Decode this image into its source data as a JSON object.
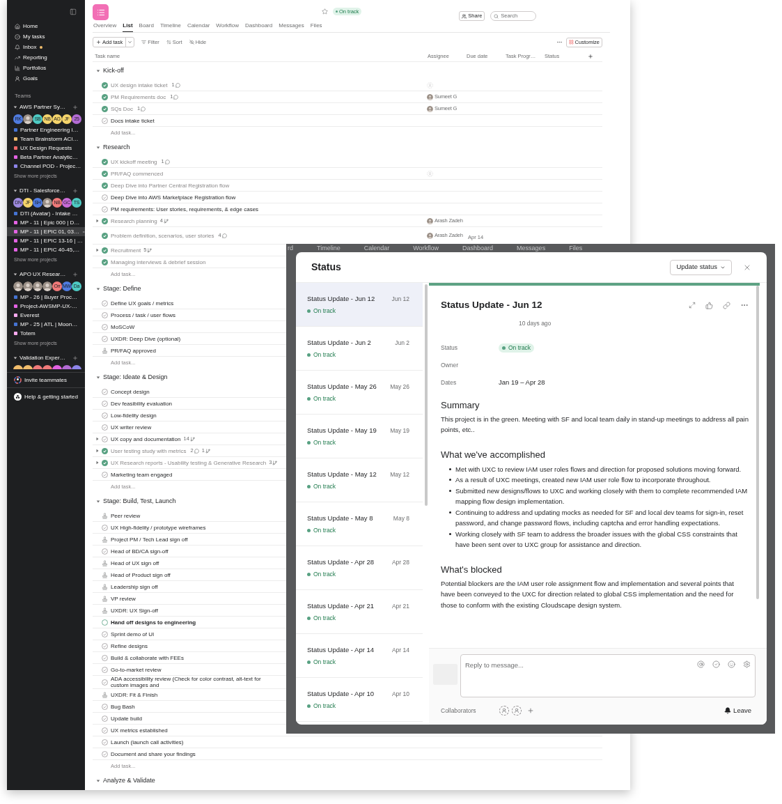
{
  "sidebar": {
    "nav": [
      {
        "label": "Home",
        "kind": "home"
      },
      {
        "label": "My tasks",
        "kind": "tasks"
      },
      {
        "label": "Inbox",
        "kind": "inbox",
        "unread": true
      },
      {
        "label": "Reporting",
        "kind": "reporting"
      },
      {
        "label": "Portfolios",
        "kind": "portfolios"
      },
      {
        "label": "Goals",
        "kind": "goals"
      }
    ],
    "teams_label": "Teams",
    "teams": [
      {
        "name": "AWS Partner Sy…",
        "expanded": true,
        "avatars": [
          {
            "kind": "initials",
            "initials": "RK",
            "color": "#4f7be0"
          },
          {
            "kind": "photo"
          },
          {
            "kind": "initials",
            "initials": "SB",
            "color": "#4ecbc4"
          },
          {
            "kind": "initials",
            "initials": "NB",
            "color": "#f5d46b"
          },
          {
            "kind": "initials",
            "initials": "AG",
            "color": "#f5d46b"
          },
          {
            "kind": "initials",
            "initials": "JF",
            "color": "#f5d46b"
          },
          {
            "kind": "initials",
            "initials": "25",
            "color": "#b36bd4"
          }
        ],
        "projects": [
          {
            "name": "Partner Engineering I…",
            "color": "#4573d2",
            "selected": false
          },
          {
            "name": "Team Brainstorm ACI…",
            "color": "#f1bd6c",
            "selected": false
          },
          {
            "name": "UX Design Requests",
            "color": "#f06a6a",
            "selected": false
          },
          {
            "name": "Beta Partner Analytic…",
            "color": "#e362e3",
            "selected": false
          },
          {
            "name": "Channel POD - Projec…",
            "color": "#8d84e8",
            "selected": false
          }
        ],
        "more": "Show more projects"
      },
      {
        "name": "DTI - Salesforce…",
        "expanded": true,
        "avatars": [
          {
            "kind": "initials",
            "initials": "DN",
            "color": "#9e8ae0"
          },
          {
            "kind": "initials",
            "initials": "JF",
            "color": "#f5d46b"
          },
          {
            "kind": "initials",
            "initials": "SH",
            "color": "#4f7be0"
          },
          {
            "kind": "photo"
          },
          {
            "kind": "initials",
            "initials": "NB",
            "color": "#f07a7a"
          },
          {
            "kind": "initials",
            "initials": "GC",
            "color": "#c86bd8"
          },
          {
            "kind": "initials",
            "initials": "TS",
            "color": "#4ecbc4"
          }
        ],
        "projects": [
          {
            "name": "DTI (Avatar) - Intake …",
            "color": "#4573d2",
            "selected": false
          },
          {
            "name": "MP - 11 | Epic 000 | D…",
            "color": "#e362e3",
            "selected": false
          },
          {
            "name": "MP - 11 | EPIC 01, 03…",
            "color": "#e362e3",
            "selected": true
          },
          {
            "name": "MP - 11 | EPIC 13-16 | …",
            "color": "#e362e3",
            "selected": false
          },
          {
            "name": "MP - 11 | EPIC 40-45,…",
            "color": "#e362e3",
            "selected": false
          }
        ],
        "more": "Show more projects"
      },
      {
        "name": "APO UX Resear…",
        "expanded": true,
        "avatars": [
          {
            "kind": "photo"
          },
          {
            "kind": "photo"
          },
          {
            "kind": "photo"
          },
          {
            "kind": "photo"
          },
          {
            "kind": "initials",
            "initials": "Orr",
            "color": "#f07a7a"
          },
          {
            "kind": "initials",
            "initials": "MW",
            "color": "#4f7be0"
          },
          {
            "kind": "initials",
            "initials": "Da",
            "color": "#4ecbc4"
          }
        ],
        "projects": [
          {
            "name": "MP - 26 | Buyer Proc…",
            "color": "#4573d2",
            "selected": false
          },
          {
            "name": "Project-AWSMP-UX-…",
            "color": "#e362e3",
            "selected": false
          },
          {
            "name": "Everest",
            "color": "#f9aaef",
            "selected": false
          },
          {
            "name": "MP - 25 | ATL | Moon…",
            "color": "#4573d2",
            "selected": false
          },
          {
            "name": "Totem",
            "color": "#f9aaef",
            "selected": false
          }
        ],
        "more": "Show more projects"
      },
      {
        "name": "Validation Exper…",
        "expanded": true,
        "avatars": [
          {
            "kind": "clipped",
            "color": "#f1bd6c"
          },
          {
            "kind": "clipped",
            "color": "#f1bd6c"
          },
          {
            "kind": "clipped",
            "color": "#f07a7a"
          },
          {
            "kind": "clipped",
            "color": "#f07a7a"
          },
          {
            "kind": "clipped",
            "color": "#e362e3"
          },
          {
            "kind": "clipped",
            "color": "#b36bd4"
          },
          {
            "kind": "clipped",
            "color": "#8d84e8"
          }
        ]
      }
    ],
    "invite": "Invite teammates",
    "help": "Help & getting started"
  },
  "header": {
    "starred": false,
    "status": "On track",
    "share": "Share",
    "search": {
      "placeholder": "Search"
    }
  },
  "tabs": [
    {
      "label": "Overview",
      "selected": false
    },
    {
      "label": "List",
      "selected": true
    },
    {
      "label": "Board",
      "selected": false
    },
    {
      "label": "Timeline",
      "selected": false
    },
    {
      "label": "Calendar",
      "selected": false
    },
    {
      "label": "Workflow",
      "selected": false
    },
    {
      "label": "Dashboard",
      "selected": false
    },
    {
      "label": "Messages",
      "selected": false
    },
    {
      "label": "Files",
      "selected": false
    }
  ],
  "toolbar": {
    "add": "Add task",
    "filter": "Filter",
    "sort": "Sort",
    "hide": "Hide",
    "customize": "Customize"
  },
  "columns": [
    "Task name",
    "Assignee",
    "Due date",
    "Task Progr…",
    "Status"
  ],
  "sections": [
    {
      "name": "Kick-off",
      "expanded": true,
      "add_label": "Add task...",
      "tasks": [
        {
          "name": "UX design intake ticket",
          "kind": "done",
          "comments": "1",
          "assignee": {
            "kind": "empty"
          }
        },
        {
          "name": "PM Requirements doc",
          "kind": "done",
          "comments": "1",
          "assignee": {
            "kind": "person",
            "name": "Sumeet G"
          }
        },
        {
          "name": "SQs Doc",
          "kind": "done",
          "comments": "1",
          "assignee": {
            "kind": "person",
            "name": "Sumeet G"
          }
        },
        {
          "name": "Docs intake ticket",
          "kind": "todo"
        }
      ]
    },
    {
      "name": "Research",
      "expanded": true,
      "add_label": "Add task...",
      "tasks": [
        {
          "name": "UX kickoff meeting",
          "kind": "done",
          "comments": "1"
        },
        {
          "name": "PR/FAQ commenced",
          "kind": "done",
          "assignee": {
            "kind": "empty"
          }
        },
        {
          "name": "Deep Dive into Partner Central Registration flow",
          "kind": "done"
        },
        {
          "name": "Deep Dive into AWS Marketplace Registration flow",
          "kind": "todo"
        },
        {
          "name": "PM requirements: User stories, requirements, & edge cases",
          "kind": "todo"
        },
        {
          "name": "Research planning",
          "kind": "done",
          "has_subtasks": true,
          "subtask_count": "4",
          "assignee": {
            "kind": "person",
            "name": "Arash Zadeh"
          }
        },
        {
          "name": "Problem definition, scenarios, user stories",
          "kind": "done",
          "comments": "4",
          "assignee": {
            "kind": "person",
            "name": "Arash Zadeh"
          },
          "due": "Apr 14"
        },
        {
          "name": "Recruitment",
          "kind": "done",
          "has_subtasks": true,
          "subtask_count": "5"
        },
        {
          "name": "Managing interviews & debrief session",
          "kind": "done"
        }
      ]
    },
    {
      "name": "Stage: Define",
      "expanded": true,
      "add_label": "Add task...",
      "tasks": [
        {
          "name": "Define UX goals / metrics",
          "kind": "todo"
        },
        {
          "name": "Process / task / user flows",
          "kind": "todo"
        },
        {
          "name": "MoSCoW",
          "kind": "todo"
        },
        {
          "name": "UXDR: Deep Dive (optional)",
          "kind": "todo"
        },
        {
          "name": "PR/FAQ approved",
          "kind": "approval"
        }
      ]
    },
    {
      "name": "Stage: Ideate & Design",
      "expanded": true,
      "add_label": "Add task...",
      "tasks": [
        {
          "name": "Concept design",
          "kind": "todo"
        },
        {
          "name": "Dev feasibility evaluation",
          "kind": "todo"
        },
        {
          "name": "Low-fidelity design",
          "kind": "todo"
        },
        {
          "name": "UX writer review",
          "kind": "todo"
        },
        {
          "name": "UX copy and documentation",
          "kind": "todo",
          "has_subtasks": true,
          "subtask_count": "14"
        },
        {
          "name": "User testing study with metrics",
          "kind": "done",
          "has_subtasks": true,
          "comments": "2",
          "subtask_count": "1"
        },
        {
          "name": "UX Research reports - Usability testing & Generative Research",
          "kind": "done",
          "has_subtasks": true,
          "subtask_count": "3"
        },
        {
          "name": "Marketing team engaged",
          "kind": "todo"
        }
      ]
    },
    {
      "name": "Stage: Build, Test, Launch",
      "expanded": true,
      "add_label": "Add task...",
      "tasks": [
        {
          "name": "Peer review",
          "kind": "approval"
        },
        {
          "name": "UX High-fidelity / prototype wireframes",
          "kind": "todo"
        },
        {
          "name": "Project PM / Tech Lead sign off",
          "kind": "approval"
        },
        {
          "name": "Head of BD/CA sign-off",
          "kind": "todo"
        },
        {
          "name": "Head of UX sign off",
          "kind": "approval"
        },
        {
          "name": "Head of Product sign off",
          "kind": "approval"
        },
        {
          "name": "Leadership sign off",
          "kind": "approval"
        },
        {
          "name": "VP review",
          "kind": "approval"
        },
        {
          "name": "UXDR: UX Sign-off",
          "kind": "approval"
        },
        {
          "name": "Hand off designs to engineering",
          "kind": "milestone"
        },
        {
          "name": "Sprint demo of UI",
          "kind": "todo"
        },
        {
          "name": "Refine designs",
          "kind": "todo"
        },
        {
          "name": "Build & collaborate with FEEs",
          "kind": "todo"
        },
        {
          "name": "Go-to-market review",
          "kind": "todo"
        },
        {
          "name": "ADA accessibility review (Check for color contrast, alt-text for custom images and",
          "kind": "todo"
        },
        {
          "name": "UXDR: Fit & Finish",
          "kind": "approval"
        },
        {
          "name": "Bug Bash",
          "kind": "todo"
        },
        {
          "name": "Update build",
          "kind": "todo"
        },
        {
          "name": "UX metrics established",
          "kind": "todo"
        },
        {
          "name": "Launch (launch call activities)",
          "kind": "todo"
        },
        {
          "name": "Document and share your findings",
          "kind": "todo"
        }
      ]
    },
    {
      "name": "Analyze & Validate",
      "expanded": true
    }
  ],
  "modal": {
    "backdrop_tabs": [
      "rd",
      "Timeline",
      "Calendar",
      "Workflow",
      "Dashboard",
      "Messages",
      "Files"
    ],
    "title": "Status",
    "update_button": "Update status",
    "updates": [
      {
        "title": "Status Update - Jun 12",
        "date": "Jun 12",
        "status": "On track",
        "selected": true
      },
      {
        "title": "Status Update - Jun 2",
        "date": "Jun 2",
        "status": "On track",
        "selected": false
      },
      {
        "title": "Status Update - May 26",
        "date": "May 26",
        "status": "On track",
        "selected": false
      },
      {
        "title": "Status Update - May 19",
        "date": "May 19",
        "status": "On track",
        "selected": false
      },
      {
        "title": "Status Update - May 12",
        "date": "May 12",
        "status": "On track",
        "selected": false
      },
      {
        "title": "Status Update - May 8",
        "date": "May 8",
        "status": "On track",
        "selected": false
      },
      {
        "title": "Status Update - Apr 28",
        "date": "Apr 28",
        "status": "On track",
        "selected": false
      },
      {
        "title": "Status Update - Apr 21",
        "date": "Apr 21",
        "status": "On track",
        "selected": false
      },
      {
        "title": "Status Update - Apr 14",
        "date": "Apr 14",
        "status": "On track",
        "selected": false
      },
      {
        "title": "Status Update - Apr 10",
        "date": "Apr 10",
        "status": "On track",
        "selected": false
      }
    ],
    "detail": {
      "title": "Status Update - Jun 12",
      "time": "10 days ago",
      "fields": [
        {
          "label": "Status",
          "kind": "status",
          "value": "On track"
        },
        {
          "label": "Owner",
          "kind": "text"
        },
        {
          "label": "Dates",
          "kind": "text",
          "value": "Jan 19 – Apr 28"
        }
      ],
      "sections": [
        {
          "heading": "Summary",
          "kind": "paragraph",
          "text": "This project is in the green. Meeting with SF and local team daily in stand-up meetings to address all pain points, etc.."
        },
        {
          "heading": "What we've accomplished",
          "kind": "bullets",
          "items": [
            "Met with UXC to review IAM user roles flows and direction for proposed solutions moving forward.",
            "As a result of UXC meetings, created new IAM user role flow to incorporate throughout.",
            "Submitted new designs/flows to UXC and working closely with them to complete recommended IAM mapping flow design implementation.",
            "Continuing to address and updating mocks as needed for SF and local dev teams for sign-in, reset password, and change password flows, including captcha and error handling expectations.",
            "Working closely with SF team to address the broader issues with the global CSS constraints that have been sent over to UXC group for assistance and direction."
          ]
        },
        {
          "heading": "What's blocked",
          "kind": "paragraph",
          "text": "Potential blockers are the IAM user role assignment flow and implementation and several points that have been conveyed to the UXC for direction related to global CSS implementation and the need for those to conform with the existing Cloudscape design system."
        }
      ]
    },
    "reply": {
      "placeholder": "Reply to message..."
    },
    "collaborators_label": "Collaborators",
    "leave": "Leave"
  }
}
